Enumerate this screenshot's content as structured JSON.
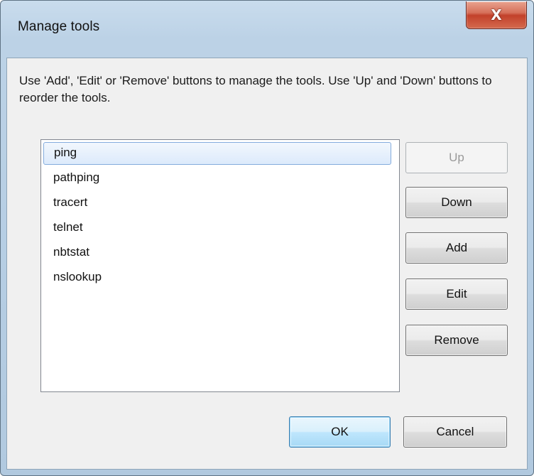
{
  "window": {
    "title": "Manage tools",
    "close_glyph": "X"
  },
  "instructions": "Use 'Add', 'Edit' or 'Remove' buttons to manage the tools. Use 'Up' and 'Down' buttons to reorder the tools.",
  "tools_list": {
    "items": [
      "ping",
      "pathping",
      "tracert",
      "telnet",
      "nbtstat",
      "nslookup"
    ],
    "selected": "ping"
  },
  "side_buttons": {
    "up": "Up",
    "down": "Down",
    "add": "Add",
    "edit": "Edit",
    "remove": "Remove"
  },
  "footer_buttons": {
    "ok": "OK",
    "cancel": "Cancel"
  },
  "colors": {
    "frame": "#b5cde3",
    "close_button": "#c2412b",
    "selection": "#dceafb",
    "default_button": "#bee6fd"
  }
}
